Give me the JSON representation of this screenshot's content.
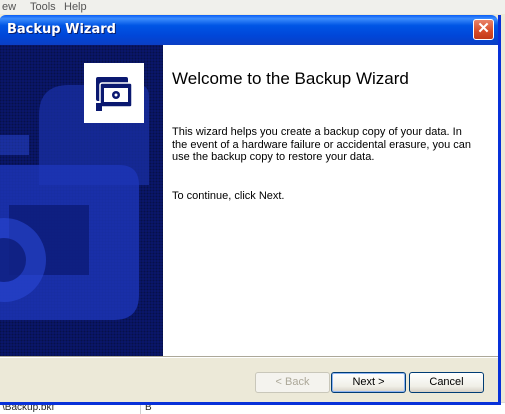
{
  "background_app": {
    "menu": [
      "ew",
      "Tools",
      "Help"
    ],
    "bottom_cells": [
      "\\Backup.bkf",
      "B"
    ]
  },
  "dialog": {
    "title": "Backup Wizard",
    "close_glyph": "✕",
    "heading": "Welcome to the Backup Wizard",
    "description": "This wizard helps you create a backup copy of your data. In the event of a hardware failure or accidental erasure, you can use the backup copy to restore your data.",
    "instruction": "To continue, click Next.",
    "icons": {
      "banner": "backup-wizard-icon",
      "close": "close-icon"
    },
    "buttons": {
      "back": "< Back",
      "next": "Next >",
      "cancel": "Cancel"
    },
    "colors": {
      "titlebar": "#0055e5",
      "banner": "#0a1870",
      "close": "#d64a27"
    }
  }
}
